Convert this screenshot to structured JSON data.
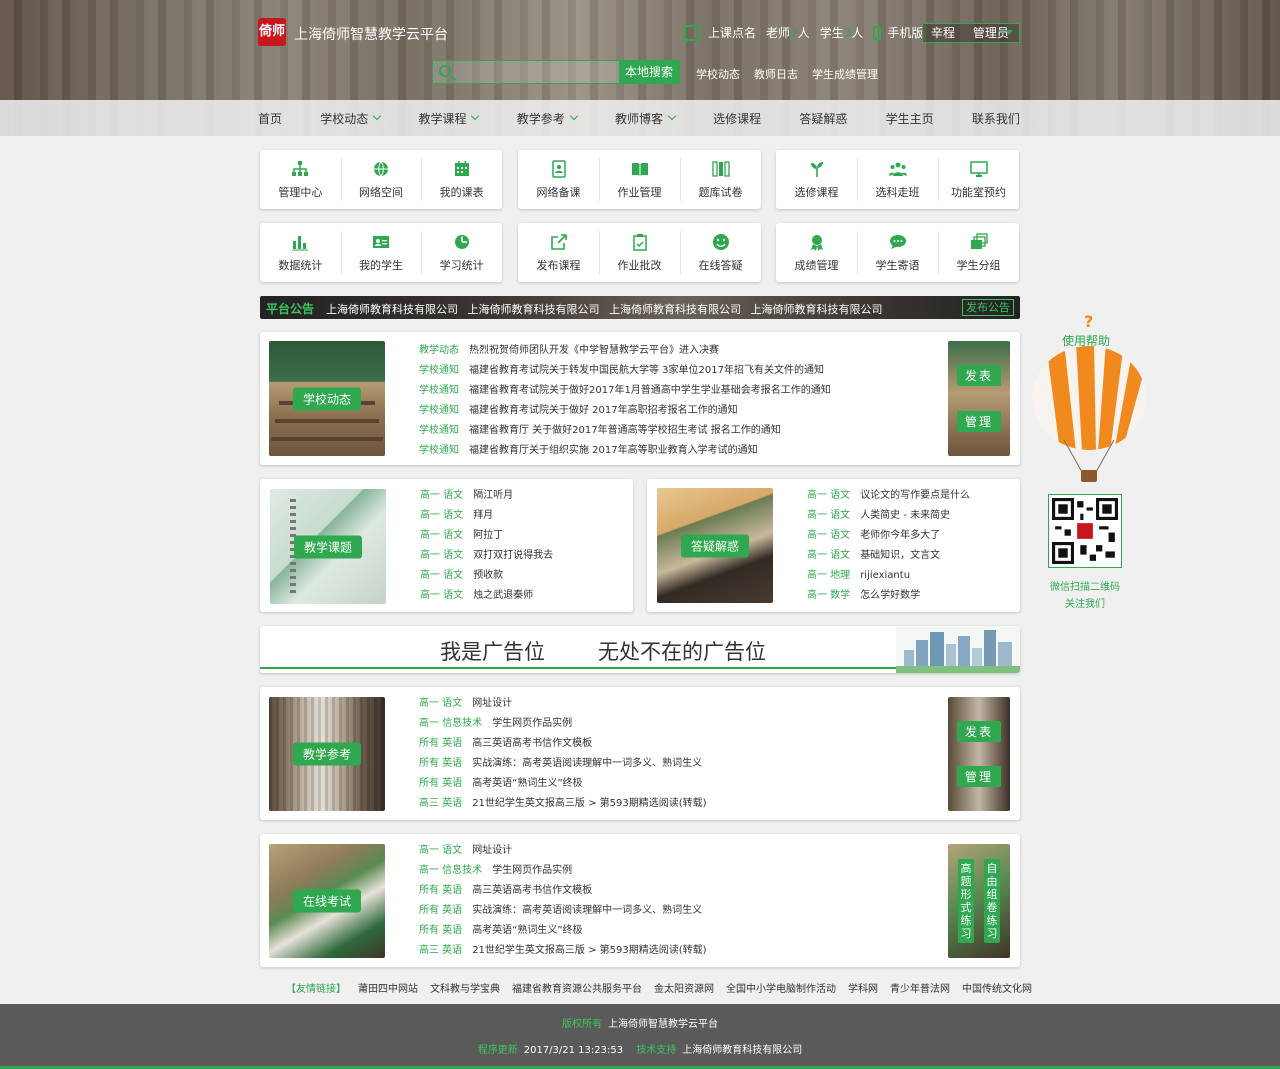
{
  "header": {
    "logo_text": "倚师",
    "site_title": "上海倚师智慧教学云平台",
    "checkin": "上课点名",
    "teachers_prefix": "老师",
    "teachers_count": "2",
    "teachers_suffix": "人",
    "students_prefix": "学生",
    "students_count": "3",
    "students_suffix": "人",
    "mobile": "手机版",
    "user_name": "辛程",
    "user_role": "管理员",
    "search_placeholder": "",
    "search_button": "本地搜索",
    "sub_links": [
      "学校动态",
      "教师日志",
      "学生成绩管理"
    ]
  },
  "nav": {
    "items": [
      {
        "label": "首页"
      },
      {
        "label": "学校动态"
      },
      {
        "label": "教学课程"
      },
      {
        "label": "教学参考"
      },
      {
        "label": "教师博客"
      },
      {
        "label": "选修课程"
      },
      {
        "label": "答疑解惑"
      },
      {
        "label": "学生主页"
      },
      {
        "label": "联系我们"
      }
    ]
  },
  "quick": {
    "panel1": [
      {
        "label": "管理中心",
        "icon": "org-chart-icon"
      },
      {
        "label": "网络空间",
        "icon": "globe-icon"
      },
      {
        "label": "我的课表",
        "icon": "calendar-icon"
      }
    ],
    "panel2": [
      {
        "label": "网络备课",
        "icon": "address-book-icon"
      },
      {
        "label": "作业管理",
        "icon": "open-book-icon"
      },
      {
        "label": "题库试卷",
        "icon": "binders-icon"
      }
    ],
    "panel3": [
      {
        "label": "选修课程",
        "icon": "sprout-icon"
      },
      {
        "label": "选科走班",
        "icon": "group-icon"
      },
      {
        "label": "功能室预约",
        "icon": "monitor-icon"
      }
    ],
    "panel4": [
      {
        "label": "数据统计",
        "icon": "bar-chart-icon"
      },
      {
        "label": "我的学生",
        "icon": "id-card-icon"
      },
      {
        "label": "学习统计",
        "icon": "pie-clock-icon"
      }
    ],
    "panel5": [
      {
        "label": "发布课程",
        "icon": "share-icon"
      },
      {
        "label": "作业批改",
        "icon": "clipboard-icon"
      },
      {
        "label": "在线答疑",
        "icon": "smile-icon"
      }
    ],
    "panel6": [
      {
        "label": "成绩管理",
        "icon": "award-icon"
      },
      {
        "label": "学生寄语",
        "icon": "chat-icon"
      },
      {
        "label": "学生分组",
        "icon": "stack-icon"
      }
    ]
  },
  "notice": {
    "label": "平台公告",
    "text": "上海倚师教育科技有限公司 上海倚师教育科技有限公司 上海倚师教育科技有限公司 上海倚师教育科技有限公司",
    "publish": "发布公告"
  },
  "school_news": {
    "badge": "学校动态",
    "items": [
      {
        "tag": "教学动态",
        "text": "热烈祝贺倚师团队开发《中学智慧教学云平台》进入决赛"
      },
      {
        "tag": "学校通知",
        "text": "福建省教育考试院关于转发中国民航大学等 3家单位2017年招飞有关文件的通知"
      },
      {
        "tag": "学校通知",
        "text": "福建省教育考试院关于做好2017年1月普通高中学生学业基础会考报名工作的通知"
      },
      {
        "tag": "学校通知",
        "text": "福建省教育考试院关于做好 2017年高职招考报名工作的通知"
      },
      {
        "tag": "学校通知",
        "text": "福建省教育厅 关于做好2017年普通高等学校招生考试 报名工作的通知"
      },
      {
        "tag": "学校通知",
        "text": "福建省教育厅关于组织实施 2017年高等职业教育入学考试的通知"
      }
    ],
    "btn_publish": "发表",
    "btn_manage": "管理"
  },
  "topics": {
    "badge": "教学课题",
    "items": [
      {
        "tag": "高一 语文",
        "text": "隔江听月"
      },
      {
        "tag": "高一 语文",
        "text": "拜月"
      },
      {
        "tag": "高一 语文",
        "text": "阿拉丁"
      },
      {
        "tag": "高一 语文",
        "text": "双打双打说得我去"
      },
      {
        "tag": "高一 语文",
        "text": "预收款"
      },
      {
        "tag": "高一 语文",
        "text": "烛之武退秦师"
      }
    ]
  },
  "qa": {
    "badge": "答疑解惑",
    "items": [
      {
        "tag": "高一 语文",
        "text": "议论文的写作要点是什么"
      },
      {
        "tag": "高一 语文",
        "text": "人类简史 - 未来简史"
      },
      {
        "tag": "高一 语文",
        "text": "老师你今年多大了"
      },
      {
        "tag": "高一 语文",
        "text": "基础知识，文言文"
      },
      {
        "tag": "高一 地理",
        "text": "rijiexiantu"
      },
      {
        "tag": "高一 数学",
        "text": "怎么学好数学"
      }
    ]
  },
  "ad": {
    "text1": "我是广告位",
    "text2": "无处不在的广告位"
  },
  "reference": {
    "badge": "教学参考",
    "items": [
      {
        "tag": "高一 语文",
        "text": "网址设计"
      },
      {
        "tag": "高一 信息技术",
        "text": "学生网页作品实例"
      },
      {
        "tag": "所有 英语",
        "text": "高三英语高考书信作文模板"
      },
      {
        "tag": "所有 英语",
        "text": "实战演练：高考英语阅读理解中一词多义、熟词生义"
      },
      {
        "tag": "所有 英语",
        "text": "高考英语“熟词生义”终极"
      },
      {
        "tag": "高三 英语",
        "text": "21世纪学生英文报高三版 > 第593期精选阅读(转载)"
      }
    ],
    "btn_publish": "发表",
    "btn_manage": "管理"
  },
  "exam": {
    "badge": "在线考试",
    "items": [
      {
        "tag": "高一 语文",
        "text": "网址设计"
      },
      {
        "tag": "高一 信息技术",
        "text": "学生网页作品实例"
      },
      {
        "tag": "所有 英语",
        "text": "高三英语高考书信作文模板"
      },
      {
        "tag": "所有 英语",
        "text": "实战演练：高考英语阅读理解中一词多义、熟词生义"
      },
      {
        "tag": "所有 英语",
        "text": "高考英语“熟词生义”终极"
      },
      {
        "tag": "高三 英语",
        "text": "21世纪学生英文报高三版 > 第593期精选阅读(转载)"
      }
    ],
    "btn_a": "高题形式练习",
    "btn_b": "自由组卷练习"
  },
  "help": {
    "label": "使用帮助",
    "qr_cap1": "微信扫描二维码",
    "qr_cap2": "关注我们"
  },
  "friends": {
    "label": "【友情链接】",
    "links": [
      "莆田四中网站",
      "文科教与学宝典",
      "福建省教育资源公共服务平台",
      "金太阳资源网",
      "全国中小学电脑制作活动",
      "学科网",
      "青少年普法网",
      "中国传统文化网"
    ]
  },
  "footer": {
    "copyright_key": "版权所有",
    "copyright_val": "上海倚师智慧教学云平台",
    "update_key": "程序更新",
    "update_val": "2017/3/21 13:23:53",
    "support_key": "技术支持",
    "support_val": "上海倚师教育科技有限公司"
  },
  "colors": {
    "accent": "#2fa84f",
    "footer_bg": "#5a5a5a",
    "logo_red": "#c8161d",
    "balloon_orange": "#f08a1e"
  }
}
